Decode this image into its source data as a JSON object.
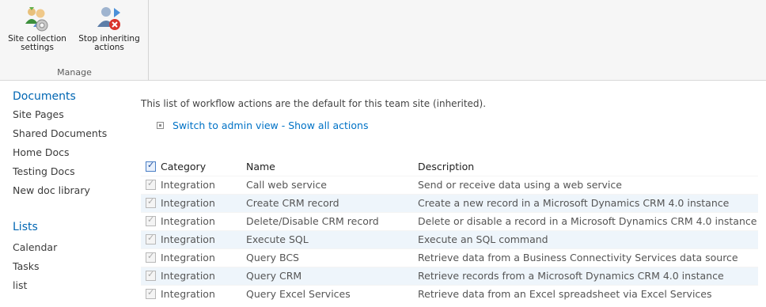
{
  "ribbon": {
    "buttons": [
      {
        "label": "Site collection\nsettings",
        "icon": "site-collection-settings-icon"
      },
      {
        "label": "Stop inheriting\nactions",
        "icon": "stop-inheriting-icon"
      }
    ],
    "group_label": "Manage"
  },
  "nav": {
    "documents_heading": "Documents",
    "documents": [
      "Site Pages",
      "Shared Documents",
      "Home Docs",
      "Testing Docs",
      "New doc library"
    ],
    "lists_heading": "Lists",
    "lists": [
      "Calendar",
      "Tasks",
      "list"
    ]
  },
  "main": {
    "intro": "This list of workflow actions are the default for this team site (inherited).",
    "switch_link": "Switch to admin view - Show all actions"
  },
  "table": {
    "headers": {
      "category": "Category",
      "name": "Name",
      "description": "Description"
    },
    "rows": [
      {
        "category": "Integration",
        "name": "Call web service",
        "description": "Send or receive data using a web service"
      },
      {
        "category": "Integration",
        "name": "Create CRM record",
        "description": "Create a new record in a Microsoft Dynamics CRM 4.0 instance"
      },
      {
        "category": "Integration",
        "name": "Delete/Disable CRM record",
        "description": "Delete or disable a record in a Microsoft Dynamics CRM 4.0 instance"
      },
      {
        "category": "Integration",
        "name": "Execute SQL",
        "description": "Execute an SQL command"
      },
      {
        "category": "Integration",
        "name": "Query BCS",
        "description": "Retrieve data from a Business Connectivity Services data source"
      },
      {
        "category": "Integration",
        "name": "Query CRM",
        "description": "Retrieve records from a Microsoft Dynamics CRM 4.0 instance"
      },
      {
        "category": "Integration",
        "name": "Query Excel Services",
        "description": "Retrieve data from an Excel spreadsheet via Excel Services"
      }
    ]
  },
  "colors": {
    "link": "#0072c6",
    "nav_heading": "#0066b3",
    "alt_row": "#eef5fb"
  }
}
